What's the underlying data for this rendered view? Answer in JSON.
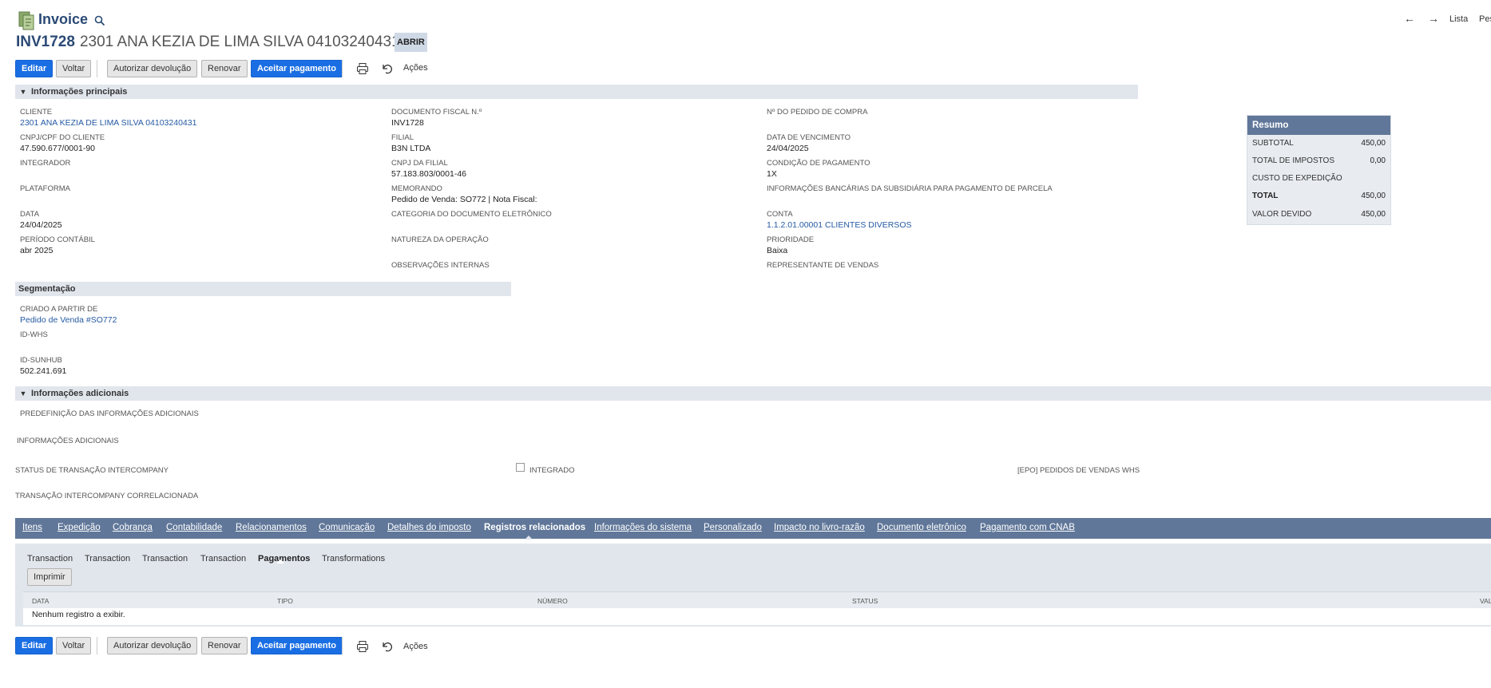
{
  "header": {
    "title": "Invoice",
    "nav_prev": "←",
    "nav_next": "→",
    "nav_list": "Lista",
    "nav_search": "Pesq",
    "record_number": "INV1728",
    "record_name": "2301 ANA KEZIA DE LIMA SILVA 04103240431",
    "status": "ABRIR"
  },
  "toolbar": {
    "edit": "Editar",
    "back": "Voltar",
    "authorize_return": "Autorizar devolução",
    "renew": "Renovar",
    "accept_payment": "Aceitar pagamento",
    "actions": "Ações"
  },
  "sections": {
    "main": "Informações principais",
    "segmentation": "Segmentação",
    "additional": "Informações adicionais"
  },
  "fields": {
    "cliente_label": "CLIENTE",
    "cliente_value": "2301 ANA KEZIA DE LIMA SILVA 04103240431",
    "cnpj_cliente_label": "CNPJ/CPF DO CLIENTE",
    "cnpj_cliente_value": "47.590.677/0001-90",
    "integrador_label": "INTEGRADOR",
    "plataforma_label": "PLATAFORMA",
    "data_label": "DATA",
    "data_value": "24/04/2025",
    "periodo_label": "PERÍODO CONTÁBIL",
    "periodo_value": "abr 2025",
    "doc_fiscal_label": "DOCUMENTO FISCAL N.º",
    "doc_fiscal_value": "INV1728",
    "filial_label": "FILIAL",
    "filial_value": "B3N LTDA",
    "cnpj_filial_label": "CNPJ DA FILIAL",
    "cnpj_filial_value": "57.183.803/0001-46",
    "memorando_label": "MEMORANDO",
    "memorando_value": "Pedido de Venda: SO772 | Nota Fiscal:",
    "categoria_label": "CATEGORIA DO DOCUMENTO ELETRÔNICO",
    "natureza_label": "NATUREZA DA OPERAÇÃO",
    "obs_label": "OBSERVAÇÕES INTERNAS",
    "pedido_compra_label": "Nº DO PEDIDO DE COMPRA",
    "vencimento_label": "DATA DE VENCIMENTO",
    "vencimento_value": "24/04/2025",
    "condicao_label": "CONDIÇÃO DE PAGAMENTO",
    "condicao_value": "1X",
    "bancarias_label": "INFORMAÇÕES BANCÁRIAS DA SUBSIDIÁRIA PARA PAGAMENTO DE PARCELA",
    "conta_label": "CONTA",
    "conta_value": "1.1.2.01.00001 CLIENTES DIVERSOS",
    "prioridade_label": "PRIORIDADE",
    "prioridade_value": "Baixa",
    "representante_label": "REPRESENTANTE DE VENDAS",
    "criado_label": "CRIADO A PARTIR DE",
    "criado_value": "Pedido de Venda #SO772",
    "idwhs_label": "ID-WHS",
    "idsunhub_label": "ID-SUNHUB",
    "idsunhub_value": "502.241.691",
    "predef_label": "PREDEFINIÇÃO DAS INFORMAÇÕES ADICIONAIS",
    "infoadic_label": "INFORMAÇÕES ADICIONAIS",
    "status_interco_label": "STATUS DE TRANSAÇÃO INTERCOMPANY",
    "integrado_label": "INTEGRADO",
    "epo_label": "[EPO] PEDIDOS DE VENDAS WHS",
    "transacao_interco_label": "TRANSAÇÃO INTERCOMPANY CORRELACIONADA"
  },
  "summary": {
    "title": "Resumo",
    "subtotal_label": "SUBTOTAL",
    "subtotal_value": "450,00",
    "impostos_label": "TOTAL DE IMPOSTOS",
    "impostos_value": "0,00",
    "expedicao_label": "CUSTO DE EXPEDIÇÃO",
    "total_label": "TOTAL",
    "total_value": "450,00",
    "devido_label": "VALOR DEVIDO",
    "devido_value": "450,00"
  },
  "tabs": [
    "Itens",
    "Expedição",
    "Cobrança",
    "Contabilidade",
    "Relacionamentos",
    "Comunicação",
    "Detalhes do imposto",
    "Registros relacionados",
    "Informações do sistema",
    "Personalizado",
    "Impacto no livro-razão",
    "Documento eletrônico",
    "Pagamento com CNAB"
  ],
  "subtabs": [
    "Transaction",
    "Transaction",
    "Transaction",
    "Transaction",
    "Pagamentos",
    "Transformations"
  ],
  "payments": {
    "print_label": "Imprimir",
    "columns": [
      "DATA",
      "TIPO",
      "NÚMERO",
      "STATUS",
      "VAL"
    ],
    "empty_message": "Nenhum registro a exibir."
  },
  "colors": {
    "accent": "#1a6ee3",
    "tab_bar": "#607799",
    "section_bar": "#e1e6ed",
    "link": "#255aa3"
  }
}
